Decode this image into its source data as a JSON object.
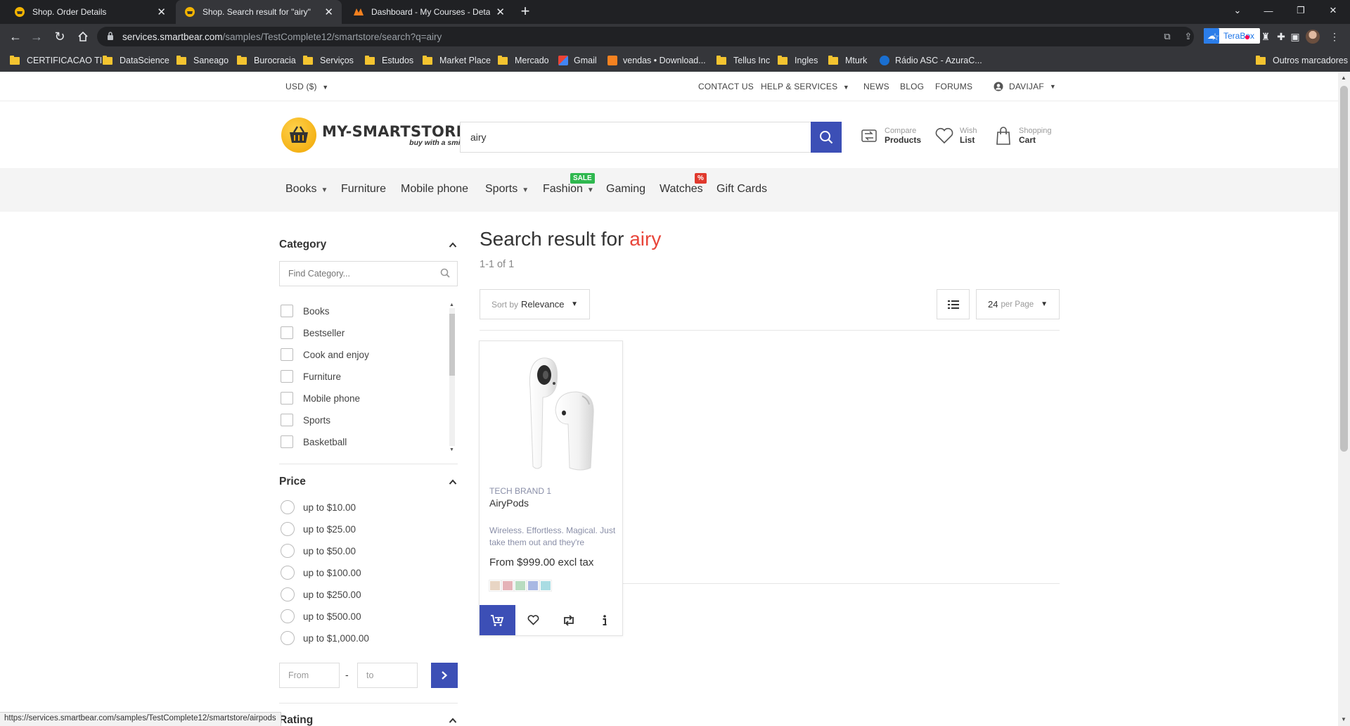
{
  "browser": {
    "tabs": [
      {
        "title": "Shop. Order Details",
        "active": false
      },
      {
        "title": "Shop. Search result for \"airy\"",
        "active": true
      },
      {
        "title": "Dashboard - My Courses - Detail",
        "active": false
      }
    ],
    "url_host": "services.smartbear.com",
    "url_path": "/samples/TestComplete12/smartstore/search?q=airy",
    "terabox_label": "TeraBox",
    "bookmarks": [
      "CERTIFICACAO TI",
      "DataScience",
      "Saneago",
      "Burocracia",
      "Serviços",
      "Estudos",
      "Market Place",
      "Mercado",
      "Gmail",
      "vendas • Download...",
      "Tellus Inc",
      "Ingles",
      "Mturk",
      "Rádio ASC - AzuraC..."
    ],
    "other_bookmarks": "Outros marcadores",
    "status_url": "https://services.smartbear.com/samples/TestComplete12/smartstore/airpods"
  },
  "utility": {
    "currency": "USD  ($)",
    "contact": "CONTACT US",
    "help": "HELP & SERVICES",
    "news": "NEWS",
    "blog": "BLOG",
    "forums": "FORUMS",
    "user": "DAVIJAF"
  },
  "header": {
    "logo_name": "MY-SMARTSTORE",
    "logo_tagline": "buy with a smile",
    "search_value": "airy",
    "compare": {
      "small": "Compare",
      "big": "Products"
    },
    "wish": {
      "small": "Wish",
      "big": "List"
    },
    "cart": {
      "small": "Shopping",
      "big": "Cart"
    }
  },
  "menu": {
    "items": [
      "Books",
      "Furniture",
      "Mobile phone",
      "Sports",
      "Fashion",
      "Gaming",
      "Watches",
      "Gift Cards"
    ],
    "fashion_badge": "SALE",
    "watches_badge": "%"
  },
  "filters": {
    "category_title": "Category",
    "category_placeholder": "Find Category...",
    "categories": [
      "Books",
      "Bestseller",
      "Cook and enjoy",
      "Furniture",
      "Mobile phone",
      "Sports",
      "Basketball"
    ],
    "price_title": "Price",
    "prices": [
      "up to $10.00",
      "up to $25.00",
      "up to $50.00",
      "up to $100.00",
      "up to $250.00",
      "up to $500.00",
      "up to $1,000.00"
    ],
    "from_placeholder": "From",
    "to_placeholder": "to",
    "rating_title": "Rating"
  },
  "results": {
    "title_prefix": "Search result for",
    "term": "airy",
    "count": "1-1 of 1",
    "sort_label": "Sort by",
    "sort_value": "Relevance",
    "per_page_value": "24",
    "per_page_label": "per Page"
  },
  "product": {
    "brand": "TECH BRAND 1",
    "name": "AiryPods",
    "description": "Wireless. Effortless. Magical. Just take them out and they're",
    "price": "From $999.00 excl tax",
    "swatches": [
      "#e8d5c4",
      "#e5b3b8",
      "#b8dcc0",
      "#a9b8e3",
      "#a9dce3"
    ]
  },
  "colors": {
    "accent": "#3c4fb6",
    "highlight": "#e8463b",
    "sale_badge": "#2fb84f",
    "percent_badge": "#e0392d"
  }
}
